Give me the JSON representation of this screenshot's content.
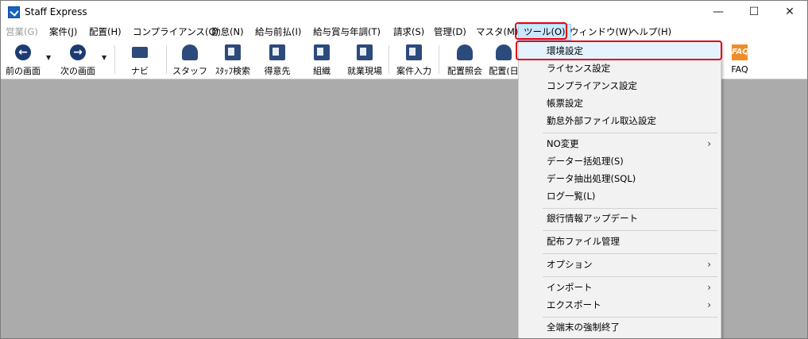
{
  "window": {
    "title": "Staff Express",
    "min_glyph": "—",
    "max_glyph": "☐",
    "close_glyph": "✕"
  },
  "menubar": [
    {
      "label": "営業(G)",
      "disabled": true
    },
    {
      "label": "案件(J)"
    },
    {
      "label": "配置(H)"
    },
    {
      "label": "コンプライアンス(C)"
    },
    {
      "label": "勤怠(N)"
    },
    {
      "label": "給与前払(I)"
    },
    {
      "label": "給与賞与年調(T)"
    },
    {
      "label": "請求(S)"
    },
    {
      "label": "管理(D)"
    },
    {
      "label": "マスタ(M)"
    },
    {
      "label": "ツール(O)",
      "active": true
    },
    {
      "label": "ウィンドウ(W)"
    },
    {
      "label": "ヘルプ(H)"
    }
  ],
  "toolbar": {
    "back": "前の画面",
    "forward": "次の画面",
    "navi": "ナビ",
    "staff": "スタッフ",
    "staff_search": "ｽﾀｯﾌ検索",
    "client": "得意先",
    "org": "組織",
    "worksite": "就業現場",
    "job_entry": "案件入力",
    "placement_inquiry": "配置照会",
    "placement_partial": "配置(日",
    "faq": "FAQ",
    "faq_icon_text": "FAQ"
  },
  "tools_menu": {
    "items": [
      {
        "label": "環境設定",
        "selected": true
      },
      {
        "label": "ライセンス設定"
      },
      {
        "label": "コンプライアンス設定"
      },
      {
        "label": "帳票設定"
      },
      {
        "label": "勤怠外部ファイル取込設定"
      },
      {
        "label": "NO変更",
        "submenu": true
      },
      {
        "label": "データー括処理(S)"
      },
      {
        "label": "データ抽出処理(SQL)"
      },
      {
        "label": "ログ一覧(L)"
      },
      {
        "label": "銀行情報アップデート"
      },
      {
        "label": "配布ファイル管理"
      },
      {
        "label": "オプション",
        "submenu": true
      },
      {
        "label": "インポート",
        "submenu": true
      },
      {
        "label": "エクスポート",
        "submenu": true
      },
      {
        "label": "全端末の強制終了"
      }
    ],
    "submenu_glyph": "›"
  },
  "colors": {
    "highlight": "#e30613",
    "menu_active_bg": "#cce8ff",
    "workspace_bg": "#ababab"
  }
}
